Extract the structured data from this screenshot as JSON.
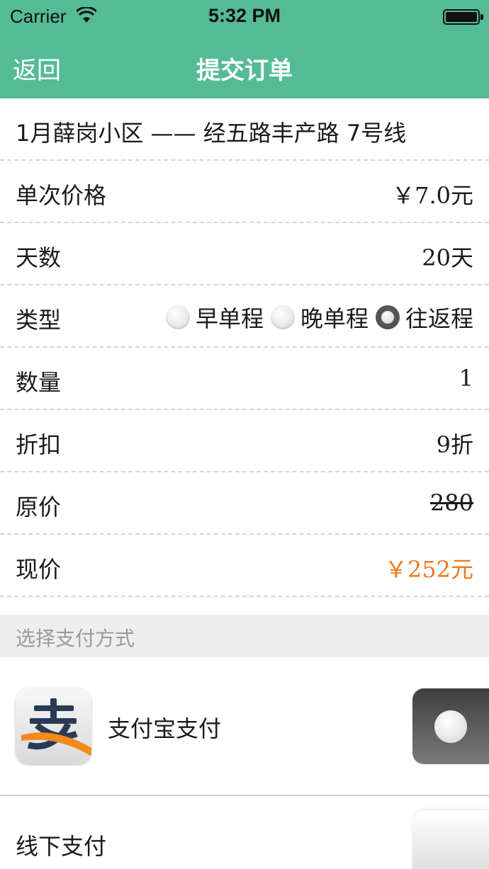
{
  "status_bar": {
    "carrier": "Carrier",
    "time": "5:32 PM"
  },
  "nav": {
    "back_label": "返回",
    "title": "提交订单"
  },
  "route": {
    "text": "1月薛岗小区 —— 经五路丰产路 7号线"
  },
  "rows": {
    "unit_price": {
      "label": "单次价格",
      "value": "￥7.0元"
    },
    "days": {
      "label": "天数",
      "value": "20天"
    },
    "type": {
      "label": "类型",
      "options": [
        {
          "label": "早单程",
          "selected": false
        },
        {
          "label": "晚单程",
          "selected": false
        },
        {
          "label": "往返程",
          "selected": true
        }
      ]
    },
    "quantity": {
      "label": "数量",
      "value": "1"
    },
    "discount": {
      "label": "折扣",
      "value": "9折"
    },
    "original_price": {
      "label": "原价",
      "value": "280"
    },
    "current_price": {
      "label": "现价",
      "value": "￥252元"
    }
  },
  "payment": {
    "section_title": "选择支付方式",
    "methods": [
      {
        "name": "支付宝支付",
        "icon": "alipay-icon",
        "selected": true
      },
      {
        "name": "线下支付",
        "selected": false
      }
    ]
  },
  "colors": {
    "nav_bg": "#55bb96",
    "price": "#f07818",
    "section_bg": "#eeeeee"
  }
}
